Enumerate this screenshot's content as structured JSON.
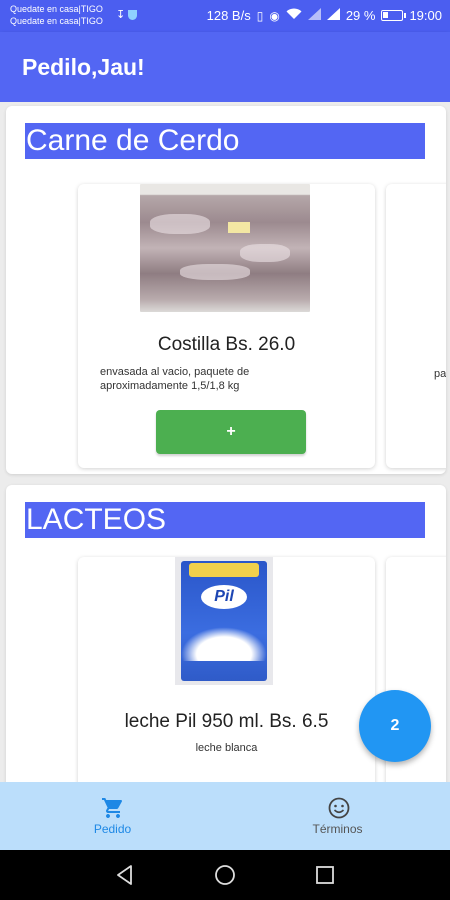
{
  "status_bar": {
    "notification_line1": "Quedate en casa|TIGO",
    "notification_line2": "Quedate en casa|TIGO",
    "net_speed": "128 B/s",
    "battery_percent": "29 %",
    "battery_level": 0.29,
    "time": "19:00",
    "icons": [
      "usb-icon",
      "shield-icon",
      "vibrate-icon",
      "eye-icon",
      "wifi-icon",
      "signal-icon",
      "signal-icon",
      "battery-icon"
    ]
  },
  "app_bar": {
    "title": "Pedilo,Jau!"
  },
  "sections": [
    {
      "title": "Carne de Cerdo",
      "product": {
        "title": "Costilla Bs. 26.0",
        "description": "envasada al vacio, paquete de aproximadamente 1,5/1,8 kg",
        "add_label": "+"
      },
      "peek_text": "pa"
    },
    {
      "title": "LACTEOS",
      "product": {
        "title": "leche Pil 950 ml. Bs. 6.5",
        "description": "leche blanca",
        "logo_text": "Pil"
      }
    }
  ],
  "fab": {
    "count": "2"
  },
  "bottom_nav": {
    "items": [
      {
        "label": "Pedido",
        "icon": "cart-icon",
        "active": true
      },
      {
        "label": "Términos",
        "icon": "smiley-icon",
        "active": false
      }
    ],
    "active_color": "#1e88e5",
    "background": "#bbdefb"
  },
  "colors": {
    "primary": "#5366f3",
    "status_bar": "#4b5ef0",
    "add_button": "#4caf50",
    "fab": "#2196f3"
  }
}
